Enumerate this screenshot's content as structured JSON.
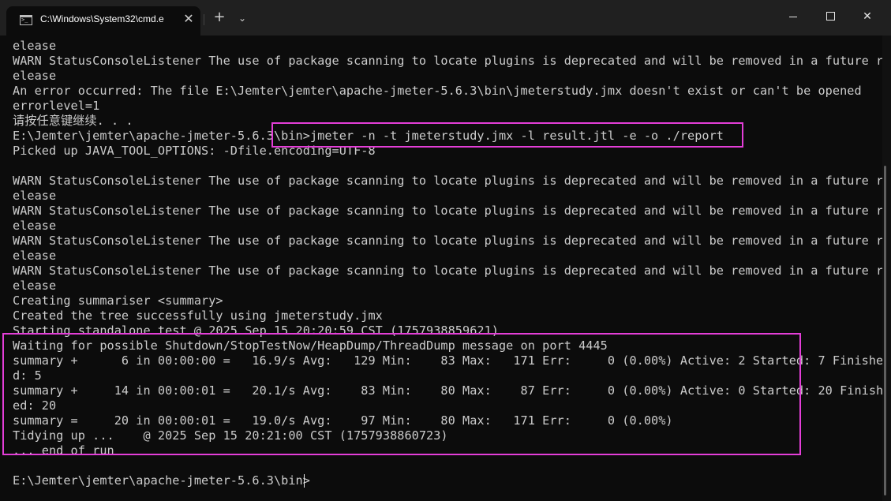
{
  "window": {
    "tab_title": "C:\\Windows\\System32\\cmd.e",
    "tab_close": "✕",
    "new_tab": "+",
    "dropdown": "⌄",
    "close_symbol": "✕"
  },
  "terminal": {
    "lines": [
      "elease",
      "WARN StatusConsoleListener The use of package scanning to locate plugins is deprecated and will be removed in a future r",
      "elease",
      "An error occurred: The file E:\\Jemter\\jemter\\apache-jmeter-5.6.3\\bin\\jmeterstudy.jmx doesn't exist or can't be opened",
      "errorlevel=1",
      "请按任意键继续. . .",
      "E:\\Jemter\\jemter\\apache-jmeter-5.6.3\\bin>jmeter -n -t jmeterstudy.jmx -l result.jtl -e -o ./report",
      "Picked up JAVA_TOOL_OPTIONS: -Dfile.encoding=UTF-8",
      "",
      "WARN StatusConsoleListener The use of package scanning to locate plugins is deprecated and will be removed in a future r",
      "elease",
      "WARN StatusConsoleListener The use of package scanning to locate plugins is deprecated and will be removed in a future r",
      "elease",
      "WARN StatusConsoleListener The use of package scanning to locate plugins is deprecated and will be removed in a future r",
      "elease",
      "WARN StatusConsoleListener The use of package scanning to locate plugins is deprecated and will be removed in a future r",
      "elease",
      "Creating summariser <summary>",
      "Created the tree successfully using jmeterstudy.jmx",
      "Starting standalone test @ 2025 Sep 15 20:20:59 CST (1757938859621)",
      "Waiting for possible Shutdown/StopTestNow/HeapDump/ThreadDump message on port 4445",
      "summary +      6 in 00:00:00 =   16.9/s Avg:   129 Min:    83 Max:   171 Err:     0 (0.00%) Active: 2 Started: 7 Finishe",
      "d: 5",
      "summary +     14 in 00:00:01 =   20.1/s Avg:    83 Min:    80 Max:    87 Err:     0 (0.00%) Active: 0 Started: 20 Finish",
      "ed: 20",
      "summary =     20 in 00:00:01 =   19.0/s Avg:    97 Min:    80 Max:   171 Err:     0 (0.00%)",
      "Tidying up ...    @ 2025 Sep 15 20:21:00 CST (1757938860723)",
      "... end of run",
      "",
      "E:\\Jemter\\jemter\\apache-jmeter-5.6.3\\bin>"
    ]
  },
  "colors": {
    "highlight": "#e43ed8",
    "text": "#cccccc",
    "background": "#0c0c0c"
  }
}
